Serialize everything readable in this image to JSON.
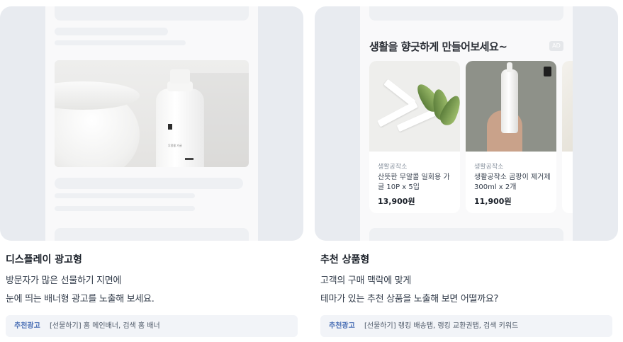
{
  "left": {
    "title": "디스플레이 광고형",
    "desc_line1": "방문자가 많은 선물하기 지면에",
    "desc_line2": "눈에 띄는 배너형 광고를 노출해 보세요.",
    "chip_label": "추천광고",
    "chip_text": "[선물하기] 홈 메인배너, 검색 홈 배너",
    "banner_product_text": "무알콜 가글"
  },
  "right": {
    "title": "추천 상품형",
    "desc_line1": "고객의 구매 맥락에 맞게",
    "desc_line2": "테마가 있는 추천 상품을 노출해 보면 어떨까요?",
    "chip_label": "추천광고",
    "chip_text": "[선물하기] 랭킹 배송탭, 랭킹 교환권탭, 검색 키워드",
    "section_title": "생활을 향긋하게 만들어보세요~",
    "ad_badge": "AD",
    "products": [
      {
        "brand": "생활공작소",
        "name": "산뜻한 무알콜 일회용 가글 10P x 5입",
        "price": "13,900원"
      },
      {
        "brand": "생활공작소",
        "name": "생활공작소 곰팡이 제거제 300ml x 2개",
        "price": "11,900원"
      }
    ]
  },
  "colors": {
    "card_bg": "#e8ebf0",
    "chip_bg": "#f2f4f8",
    "chip_label": "#4a6fb5"
  }
}
